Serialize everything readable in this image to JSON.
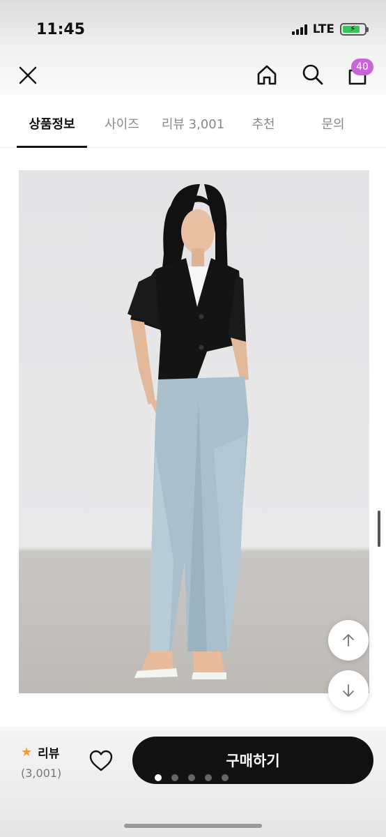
{
  "status": {
    "time": "11:45",
    "network": "LTE",
    "battery_level": 0.8
  },
  "header": {
    "cart_count": "40",
    "icons": [
      "close-icon",
      "home-icon",
      "search-icon",
      "cart-icon"
    ]
  },
  "tabs": [
    {
      "label": "상품정보",
      "active": true
    },
    {
      "label": "사이즈",
      "active": false
    },
    {
      "label": "리뷰 3,001",
      "active": false
    },
    {
      "label": "추천",
      "active": false
    },
    {
      "label": "문의",
      "active": false
    }
  ],
  "bottom": {
    "review_label": "리뷰",
    "review_count": "(3,001)",
    "buy_label": "구매하기",
    "page_dots": 5,
    "active_dot": 0
  },
  "colors": {
    "badge": "#c863d8",
    "star": "#f29a32",
    "buy_button": "#111111"
  }
}
